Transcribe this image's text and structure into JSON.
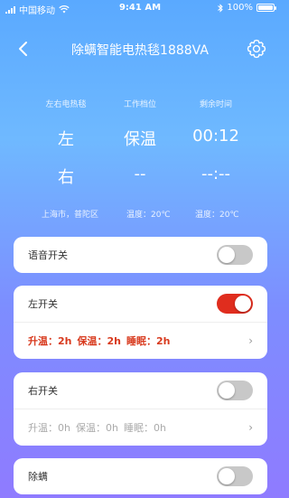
{
  "status": {
    "carrier": "中国移动",
    "time": "9:41 AM",
    "battery": "100%"
  },
  "nav": {
    "title": "除螨智能电热毯1888VA"
  },
  "info": {
    "labels": {
      "side": "左右电热毯",
      "mode": "工作档位",
      "remaining": "剩余时间"
    },
    "rows": [
      {
        "side": "左",
        "mode": "保温",
        "remaining": "00:12"
      },
      {
        "side": "右",
        "mode": "--",
        "remaining": "--:--"
      }
    ],
    "location": "上海市，普陀区",
    "temp1": "温度：20℃",
    "temp2": "温度：20℃"
  },
  "cards": {
    "voice": {
      "label": "语音开关",
      "on": false
    },
    "left": {
      "label": "左开关",
      "on": true,
      "detail": {
        "up": "升温：2h",
        "keep": "保温：2h",
        "sleep": "睡眠：2h"
      }
    },
    "right": {
      "label": "右开关",
      "on": false,
      "detail": {
        "up": "升温：0h",
        "keep": "保温：0h",
        "sleep": "睡眠：0h"
      }
    },
    "mite": {
      "label": "除螨",
      "on": false
    }
  }
}
